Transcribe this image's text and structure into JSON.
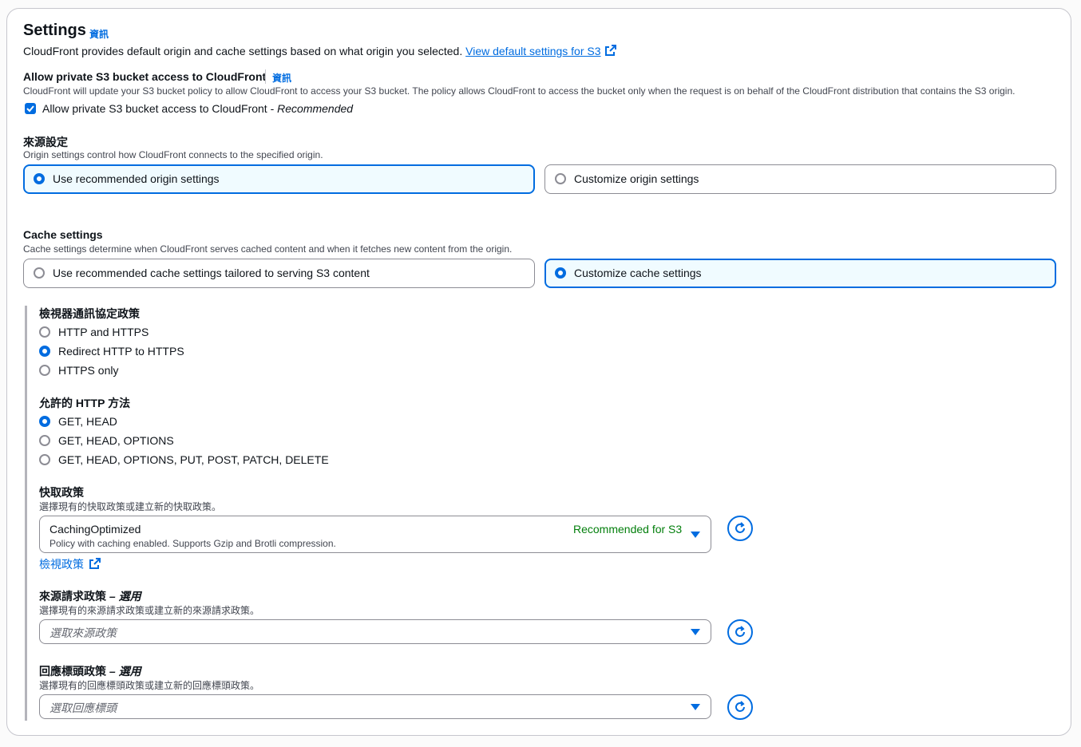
{
  "settings": {
    "title": "Settings",
    "info": "資訊",
    "description": "CloudFront provides default origin and cache settings based on what origin you selected.",
    "view_defaults_link": "View default settings for S3"
  },
  "s3_access": {
    "title": "Allow private S3 bucket access to CloudFront",
    "info": "資訊",
    "description": "CloudFront will update your S3 bucket policy to allow CloudFront to access your S3 bucket. The policy allows CloudFront to access the bucket only when the request is on behalf of the CloudFront distribution that contains the S3 origin.",
    "checkbox_label": "Allow private S3 bucket access to CloudFront - ",
    "checkbox_suffix": "Recommended",
    "checked": true
  },
  "origin_settings": {
    "title": "來源設定",
    "description": "Origin settings control how CloudFront connects to the specified origin.",
    "options": [
      {
        "label": "Use recommended origin settings",
        "selected": true
      },
      {
        "label": "Customize origin settings",
        "selected": false
      }
    ]
  },
  "cache_settings": {
    "title": "Cache settings",
    "description": "Cache settings determine when CloudFront serves cached content and when it fetches new content from the origin.",
    "options": [
      {
        "label": "Use recommended cache settings tailored to serving S3 content",
        "selected": false
      },
      {
        "label": "Customize cache settings",
        "selected": true
      }
    ]
  },
  "viewer_protocol": {
    "title": "檢視器通訊協定政策",
    "options": [
      {
        "label": "HTTP and HTTPS",
        "selected": false
      },
      {
        "label": "Redirect HTTP to HTTPS",
        "selected": true
      },
      {
        "label": "HTTPS only",
        "selected": false
      }
    ]
  },
  "http_methods": {
    "title": "允許的 HTTP 方法",
    "options": [
      {
        "label": "GET, HEAD",
        "selected": true
      },
      {
        "label": "GET, HEAD, OPTIONS",
        "selected": false
      },
      {
        "label": "GET, HEAD, OPTIONS, PUT, POST, PATCH, DELETE",
        "selected": false
      }
    ]
  },
  "cache_policy": {
    "title": "快取政策",
    "description": "選擇現有的快取政策或建立新的快取政策。",
    "value": "CachingOptimized",
    "value_description": "Policy with caching enabled. Supports Gzip and Brotli compression.",
    "tag": "Recommended for S3",
    "view_link": "檢視政策"
  },
  "origin_request_policy": {
    "title": "來源請求政策",
    "optional": " – 選用",
    "description": "選擇現有的來源請求政策或建立新的來源請求政策。",
    "placeholder": "選取來源政策"
  },
  "response_headers_policy": {
    "title": "回應標頭政策",
    "optional": " – 選用",
    "description": "選擇現有的回應標頭政策或建立新的回應標頭政策。",
    "placeholder": "選取回應標頭"
  },
  "colors": {
    "accent": "#006ce0",
    "success": "#037f0c",
    "border": "#8c8c94",
    "selected_bg": "#f0fbff"
  },
  "icons": {
    "external": "external-link-icon",
    "refresh": "refresh-icon",
    "caret": "caret-down-icon"
  }
}
